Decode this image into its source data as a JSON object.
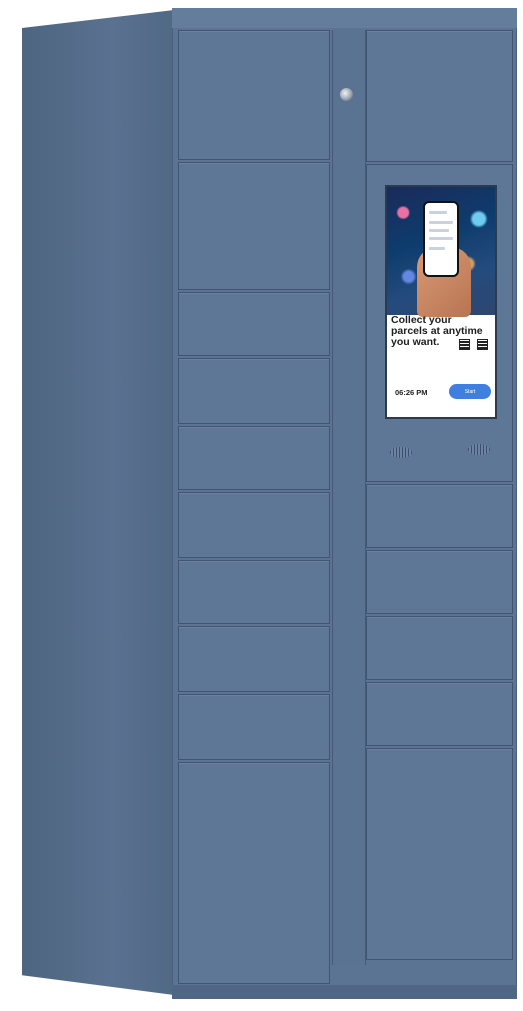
{
  "image": {
    "subject": "parcel-locker-cabinet",
    "colors": {
      "cabinet": "#5b7494",
      "side": "#4e6580",
      "accent_button": "#3f7fe0"
    }
  },
  "screen": {
    "headline_lines": [
      "Collect your",
      "parcels at anytime",
      "you want."
    ],
    "time": "06:26 PM",
    "button_label": "Start"
  }
}
